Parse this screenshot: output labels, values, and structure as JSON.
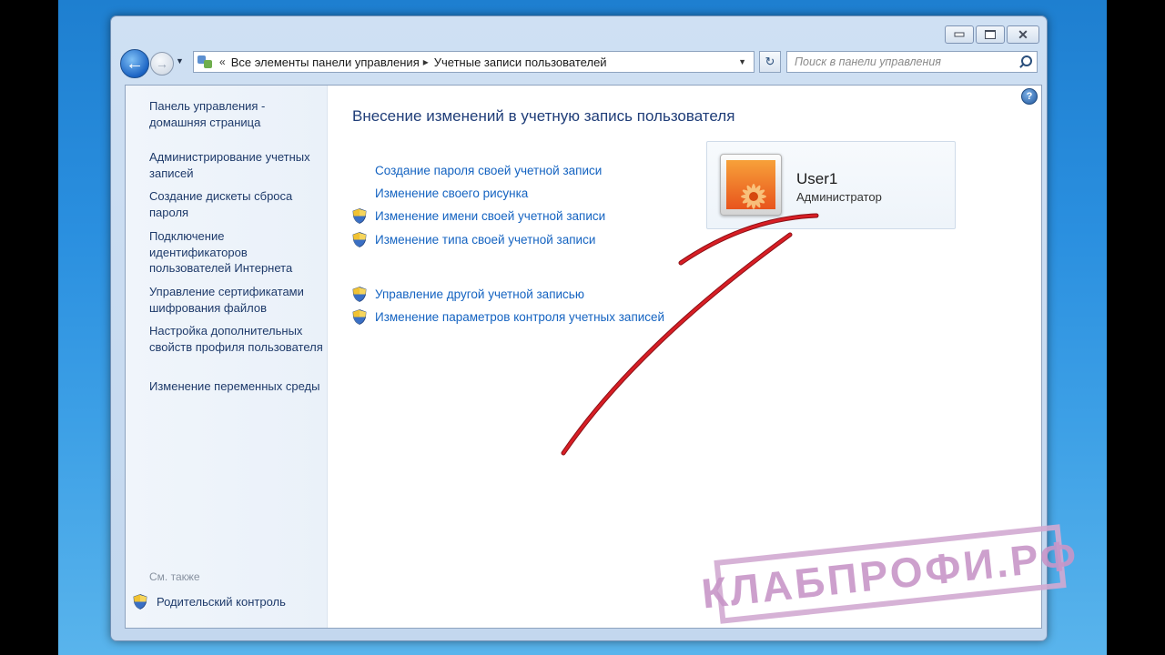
{
  "window": {
    "caption_buttons": {
      "minimize": "minimize",
      "maximize": "maximize",
      "close": "✕"
    }
  },
  "navbar": {
    "back_icon": "back-arrow-icon",
    "forward_icon": "forward-arrow-icon",
    "breadcrumb_prefix": "«",
    "breadcrumb": [
      "Все элементы панели управления",
      "Учетные записи пользователей"
    ],
    "breadcrumb_separator": "▸",
    "search_placeholder": "Поиск в панели управления"
  },
  "left_pane": {
    "links": [
      "Панель управления - домашняя страница",
      "Администрирование учетных записей",
      "Создание дискеты сброса пароля",
      "Подключение идентификаторов пользователей Интернета",
      "Управление сертификатами шифрования файлов",
      "Настройка дополнительных свойств профиля пользователя",
      "Изменение переменных среды"
    ],
    "see_also": "См. также",
    "parental_control": "Родительский контроль"
  },
  "main": {
    "title": "Внесение изменений в учетную запись пользователя",
    "tasks": [
      {
        "label": "Создание пароля своей учетной записи",
        "shield": false
      },
      {
        "label": "Изменение своего рисунка",
        "shield": false
      },
      {
        "label": "Изменение имени своей учетной записи",
        "shield": true
      },
      {
        "label": "Изменение типа своей учетной записи",
        "shield": true
      }
    ],
    "other_tasks": [
      {
        "label": "Управление другой учетной записью",
        "shield": true
      },
      {
        "label": "Изменение параметров контроля учетных записей",
        "shield": true
      }
    ],
    "help_icon": "?"
  },
  "user": {
    "name": "User1",
    "role": "Администратор"
  },
  "watermark": "КЛАБПРОФИ.РФ",
  "colors": {
    "link": "#1463c1",
    "title": "#1f3d78",
    "annotation": "#c4161c",
    "desktop": "#2a8fdf"
  }
}
